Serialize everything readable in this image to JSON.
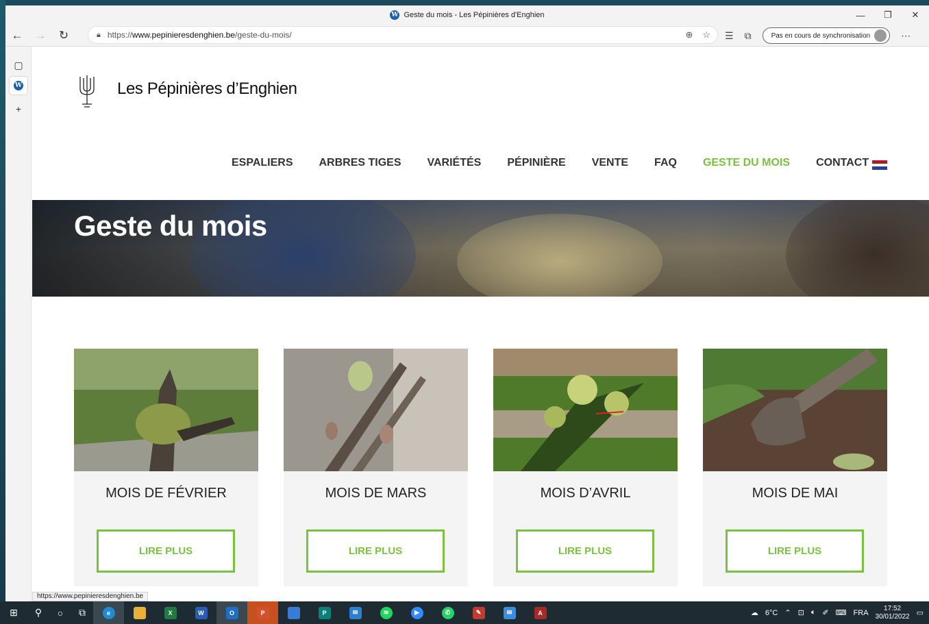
{
  "browser": {
    "tab_title": "Geste du mois - Les Pépinières d'Enghien",
    "url_prefix": "https://",
    "url_domain": "www.pepinieresdenghien.be",
    "url_path": "/geste-du-mois/",
    "sync_label": "Pas en cours de synchronisation",
    "status_url": "https://www.pepinieresdenghien.be"
  },
  "site": {
    "title": "Les Pépinières d’Enghien",
    "nav": [
      {
        "label": "ESPALIERS",
        "active": false
      },
      {
        "label": "ARBRES TIGES",
        "active": false
      },
      {
        "label": "VARIÉTÉS",
        "active": false
      },
      {
        "label": "PÉPINIÈRE",
        "active": false
      },
      {
        "label": "VENTE",
        "active": false
      },
      {
        "label": "FAQ",
        "active": false
      },
      {
        "label": "GESTE DU MOIS",
        "active": true
      },
      {
        "label": "CONTACT",
        "active": false
      }
    ],
    "language_flag": "netherlands-flag"
  },
  "hero": {
    "title": "Geste du mois"
  },
  "cards": [
    {
      "title": "MOIS DE FÉVRIER",
      "button": "LIRE PLUS"
    },
    {
      "title": "MOIS DE MARS",
      "button": "LIRE PLUS"
    },
    {
      "title": "MOIS D’AVRIL",
      "button": "LIRE PLUS"
    },
    {
      "title": "MOIS DE MAI",
      "button": "LIRE PLUS"
    }
  ],
  "taskbar": {
    "weather": "6°C",
    "language": "FRA",
    "time": "17:52",
    "date": "30/01/2022"
  },
  "colors": {
    "accent": "#7ac142",
    "text": "#333333"
  }
}
